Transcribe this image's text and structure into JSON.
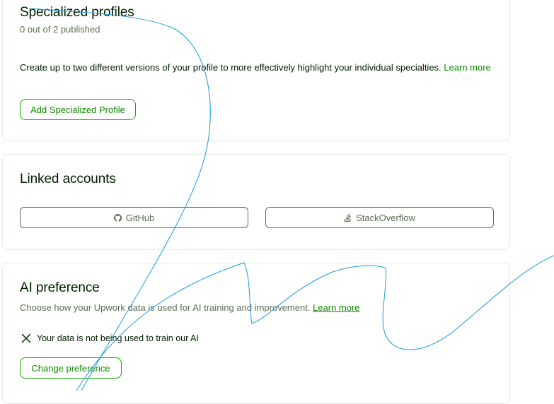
{
  "specialized_profiles": {
    "title": "Specialized profiles",
    "status": "0 out of 2 published",
    "description": "Create up to two different versions of your profile to more effectively highlight your individual specialties.",
    "learn_more": "Learn more",
    "add_button": "Add Specialized Profile"
  },
  "linked_accounts": {
    "title": "Linked accounts",
    "github_label": "GitHub",
    "stackoverflow_label": "StackOverflow"
  },
  "ai_preference": {
    "title": "AI preference",
    "description": "Choose how your Upwork data is used for AI training and improvement.",
    "learn_more": "Learn more",
    "status_icon": "x-icon",
    "status_text": "Your data is not being used to train our AI",
    "change_button": "Change preference"
  },
  "colors": {
    "accent_green": "#108a00",
    "border_green": "#14a800",
    "text_dark": "#001e00",
    "text_muted": "#5e6d55",
    "annotation_blue": "#1a9bd7"
  }
}
